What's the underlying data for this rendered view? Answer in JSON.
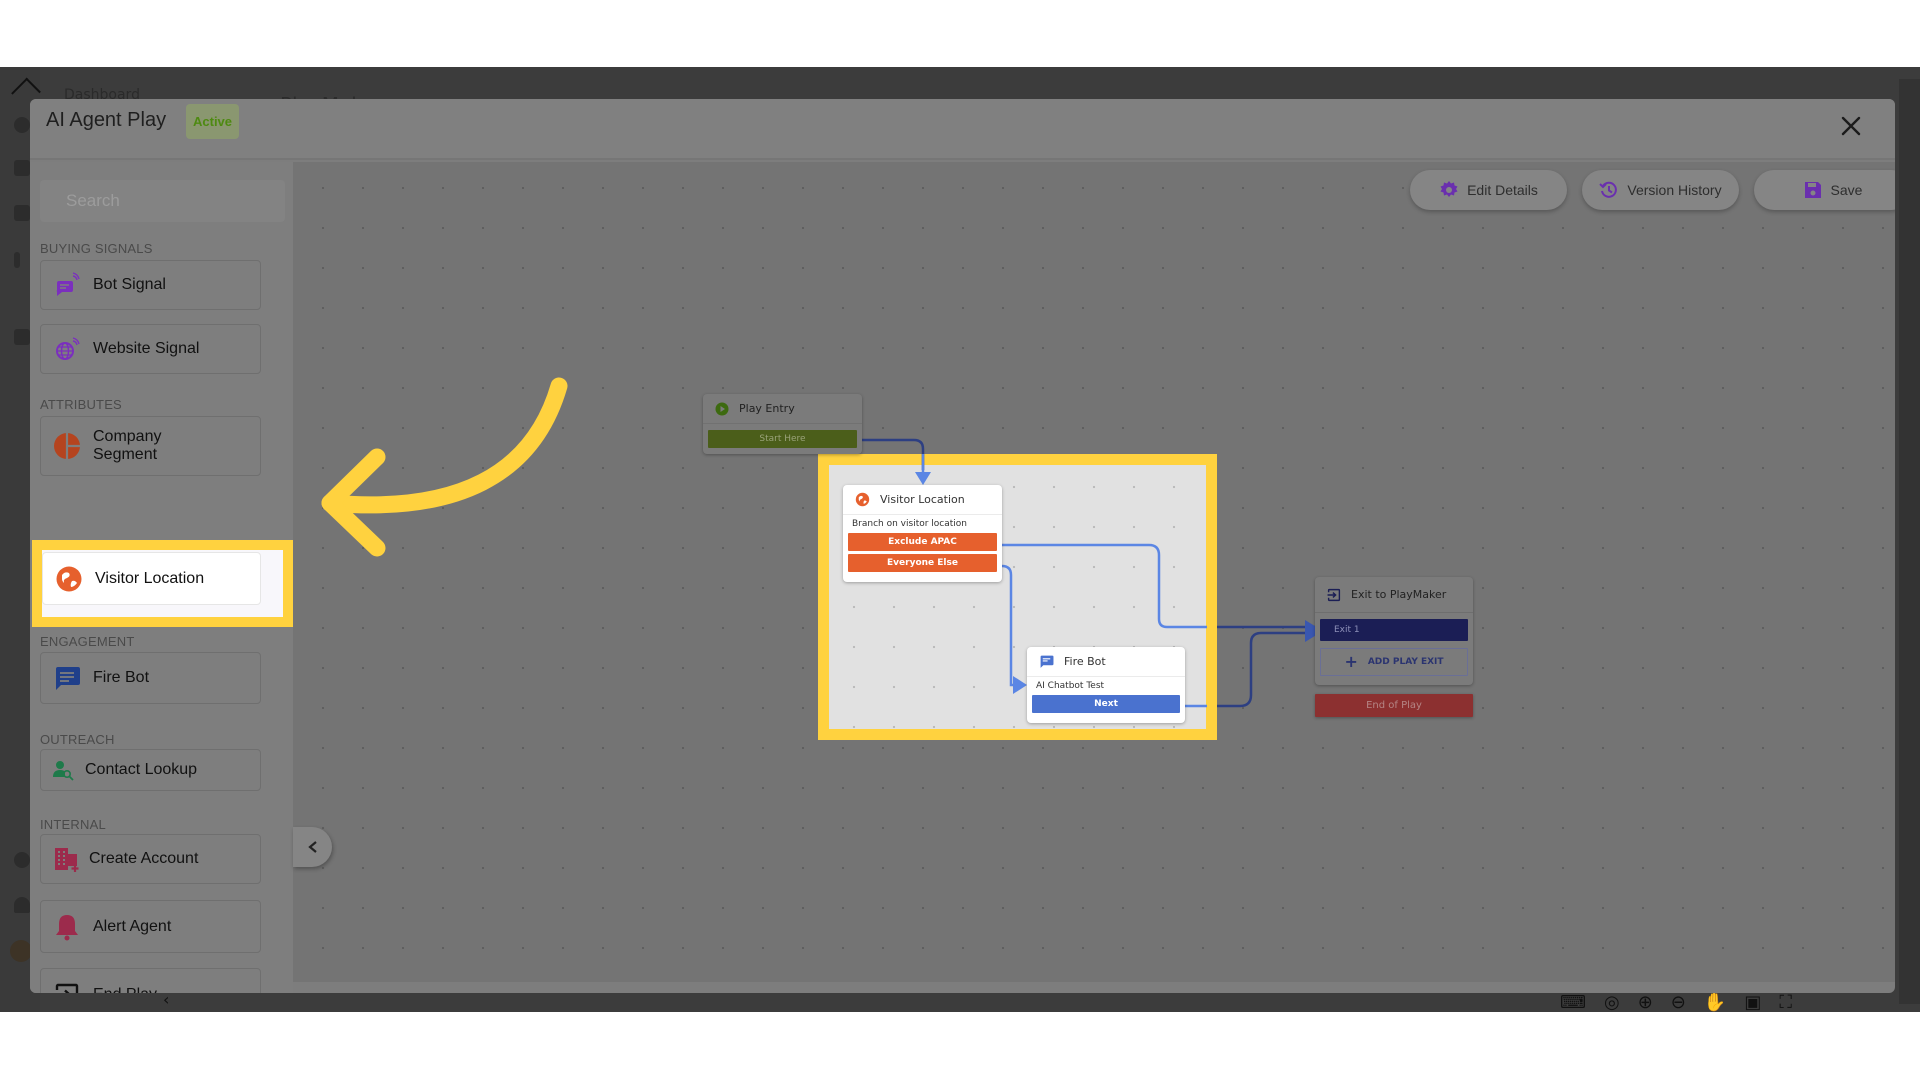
{
  "background_app": {
    "nav_text": "Dashboard",
    "page_title": "PlayMaker"
  },
  "modal": {
    "title": "AI Agent Play",
    "status": "Active",
    "close_icon": "close-icon"
  },
  "sidebar": {
    "search_placeholder": "Search",
    "sections": [
      {
        "label": "BUYING SIGNALS",
        "items": [
          {
            "label": "Bot Signal",
            "icon": "bot-signal-icon",
            "color": "#7b2fbe"
          },
          {
            "label": "Website Signal",
            "icon": "website-signal-icon",
            "color": "#7b2fbe"
          }
        ]
      },
      {
        "label": "ATTRIBUTES",
        "items": [
          {
            "label": "Company Segment",
            "icon": "pie-chart-icon",
            "color": "#b5441f"
          },
          {
            "label": "Visitor Location",
            "icon": "globe-icon",
            "color": "#e6602d",
            "highlighted": true
          }
        ]
      },
      {
        "label": "ENGAGEMENT",
        "items": [
          {
            "label": "Fire Bot",
            "icon": "chat-icon",
            "color": "#1f3f8a"
          }
        ]
      },
      {
        "label": "OUTREACH",
        "items": [
          {
            "label": "Contact Lookup",
            "icon": "contact-search-icon",
            "color": "#1e7a4a"
          }
        ]
      },
      {
        "label": "INTERNAL",
        "items": [
          {
            "label": "Create Account",
            "icon": "building-add-icon",
            "color": "#9c2b4c"
          },
          {
            "label": "Alert Agent",
            "icon": "bell-icon",
            "color": "#9c2b4c"
          },
          {
            "label": "End Play",
            "icon": "exit-icon",
            "color": "#111111"
          }
        ]
      }
    ]
  },
  "toolbar": {
    "edit_details": "Edit Details",
    "version_history": "Version History",
    "save": "Save",
    "accent_color": "#6a2fae"
  },
  "canvas": {
    "nodes": {
      "play_entry": {
        "title": "Play Entry",
        "button": "Start Here",
        "color": "#4b5e1a"
      },
      "visitor_location": {
        "title": "Visitor Location",
        "subtitle": "Branch on visitor location",
        "branches": [
          "Exclude APAC",
          "Everyone Else"
        ],
        "color": "#e6602d"
      },
      "fire_bot": {
        "title": "Fire Bot",
        "subtitle": "AI Chatbot Test",
        "button": "Next",
        "color": "#4a72cf"
      },
      "exit": {
        "title": "Exit to PlayMaker",
        "exit_label": "Exit 1",
        "add_exit": "ADD PLAY EXIT",
        "color": "#1b1e55"
      },
      "end_of_play": {
        "label": "End of Play",
        "color": "#8c3030"
      }
    },
    "controls": [
      "keyboard-icon",
      "focus-icon",
      "zoom-in-icon",
      "zoom-out-icon",
      "hand-icon",
      "fullscreen-icon"
    ]
  },
  "annotation": {
    "highlight_color": "#ffd23f"
  }
}
